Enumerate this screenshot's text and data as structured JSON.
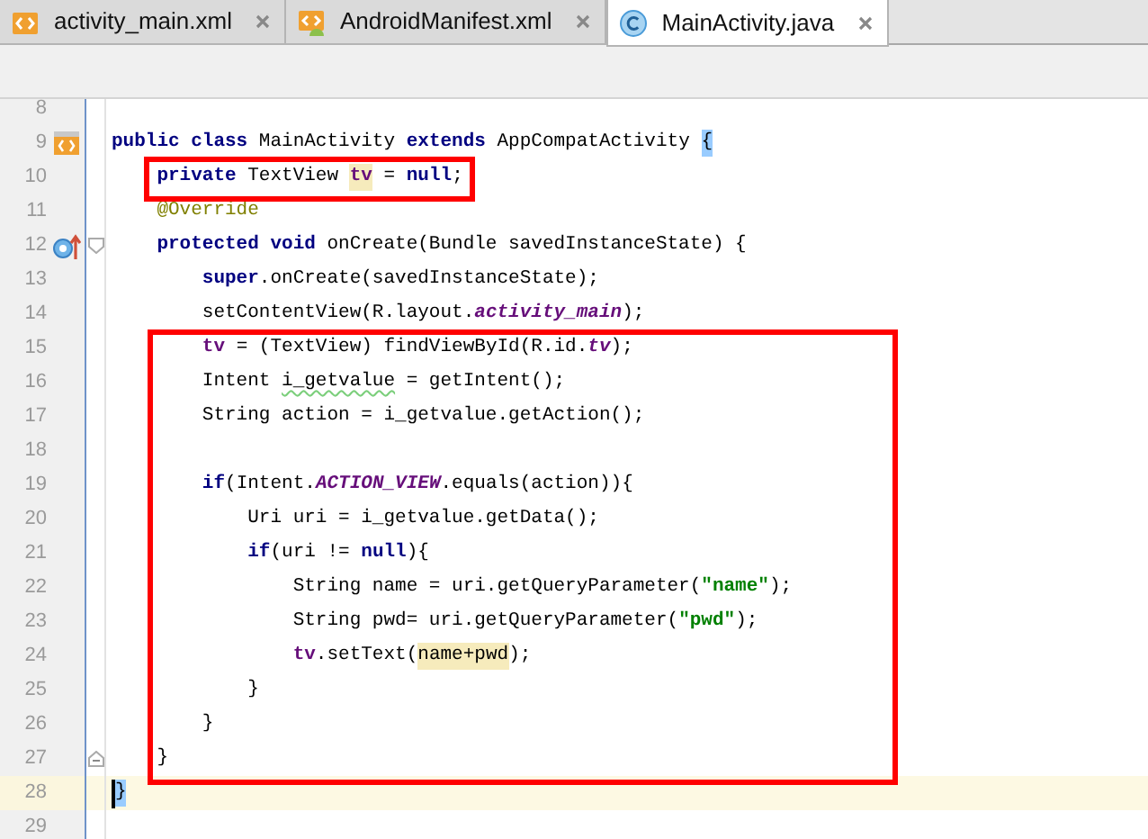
{
  "tabs": [
    {
      "label": "activity_main.xml",
      "kind": "xml",
      "selected": false
    },
    {
      "label": "AndroidManifest.xml",
      "kind": "manifest",
      "selected": false
    },
    {
      "label": "MainActivity.java",
      "kind": "class",
      "selected": true
    }
  ],
  "editor": {
    "blocks": [
      {
        "framed": false,
        "lines": [
          {
            "n": "8"
          },
          {
            "n": "9",
            "gutter_icon": {
              "kind": "xml"
            },
            "tokens": [
              {
                "t": "public class",
                "kind": "keyword"
              },
              {
                "t": " MainActivity "
              },
              {
                "t": "extends",
                "kind": "keyword"
              },
              {
                "t": " AppCompatActivity "
              },
              {
                "t": "{",
                "brace_match": true
              }
            ]
          },
          {
            "n": "10",
            "boxed": true,
            "tokens": [
              {
                "t": "    private",
                "kind": "keyword"
              },
              {
                "t": " TextView "
              },
              {
                "t": "tv",
                "kind": "field",
                "usage_highlight": true
              },
              {
                "t": " = "
              },
              {
                "t": "null",
                "kind": "keyword"
              },
              {
                "t": ";"
              }
            ]
          },
          {
            "n": "11",
            "tokens": [
              {
                "t": "    @Override",
                "kind": "annotation"
              }
            ]
          },
          {
            "n": "12",
            "gutter_icon": {
              "kind": "override"
            },
            "fold_start": true,
            "tokens": [
              {
                "t": "    protected void",
                "kind": "keyword"
              },
              {
                "t": " onCreate(Bundle savedInstanceState) {"
              }
            ]
          },
          {
            "n": "13",
            "tokens": [
              {
                "t": "        super",
                "kind": "keyword"
              },
              {
                "t": ".onCreate(savedInstanceState);"
              }
            ]
          },
          {
            "n": "14",
            "tokens": [
              {
                "t": "        setContentView(R.layout."
              },
              {
                "t": "activity_main",
                "kind": "static"
              },
              {
                "t": ");"
              }
            ]
          }
        ]
      },
      {
        "framed": true,
        "lines": [
          {
            "n": "15",
            "tokens": [
              {
                "t": "        tv",
                "kind": "field"
              },
              {
                "t": " = (TextView) findViewById(R.id."
              },
              {
                "t": "tv",
                "kind": "static"
              },
              {
                "t": ");"
              }
            ]
          },
          {
            "n": "16",
            "tokens": [
              {
                "t": "        Intent "
              },
              {
                "t": "i_getvalue",
                "typo_warning": true
              },
              {
                "t": " = getIntent();"
              }
            ]
          },
          {
            "n": "17",
            "tokens": [
              {
                "t": "        String action = i_getvalue.getAction();"
              }
            ]
          },
          {
            "n": "18"
          },
          {
            "n": "19",
            "tokens": [
              {
                "t": "        if",
                "kind": "keyword"
              },
              {
                "t": "(Intent."
              },
              {
                "t": "ACTION_VIEW",
                "kind": "static"
              },
              {
                "t": ".equals(action)){"
              }
            ]
          },
          {
            "n": "20",
            "tokens": [
              {
                "t": "            Uri uri = i_getvalue.getData();"
              }
            ]
          },
          {
            "n": "21",
            "tokens": [
              {
                "t": "            if",
                "kind": "keyword"
              },
              {
                "t": "(uri != "
              },
              {
                "t": "null",
                "kind": "keyword"
              },
              {
                "t": "){"
              }
            ]
          },
          {
            "n": "22",
            "tokens": [
              {
                "t": "                String name = uri.getQueryParameter("
              },
              {
                "t": "\"name\"",
                "kind": "string"
              },
              {
                "t": ");"
              }
            ]
          },
          {
            "n": "23",
            "tokens": [
              {
                "t": "                String pwd= uri.getQueryParameter("
              },
              {
                "t": "\"pwd\"",
                "kind": "string"
              },
              {
                "t": ");"
              }
            ]
          },
          {
            "n": "24",
            "tokens": [
              {
                "t": "                tv",
                "kind": "field"
              },
              {
                "t": ".setText("
              },
              {
                "t": "name+pwd",
                "usage_highlight": true
              },
              {
                "t": ");"
              }
            ]
          },
          {
            "n": "25",
            "tokens": [
              {
                "t": "            }"
              }
            ]
          },
          {
            "n": "26",
            "tokens": [
              {
                "t": "        }"
              }
            ]
          },
          {
            "n": "27",
            "fold_end": true,
            "tokens": [
              {
                "t": "    }"
              }
            ]
          }
        ]
      },
      {
        "framed": false,
        "lines": [
          {
            "n": "28",
            "current": true,
            "caret": true,
            "tokens": [
              {
                "t": "}",
                "brace_match": true
              }
            ]
          },
          {
            "n": "29"
          }
        ]
      }
    ]
  }
}
